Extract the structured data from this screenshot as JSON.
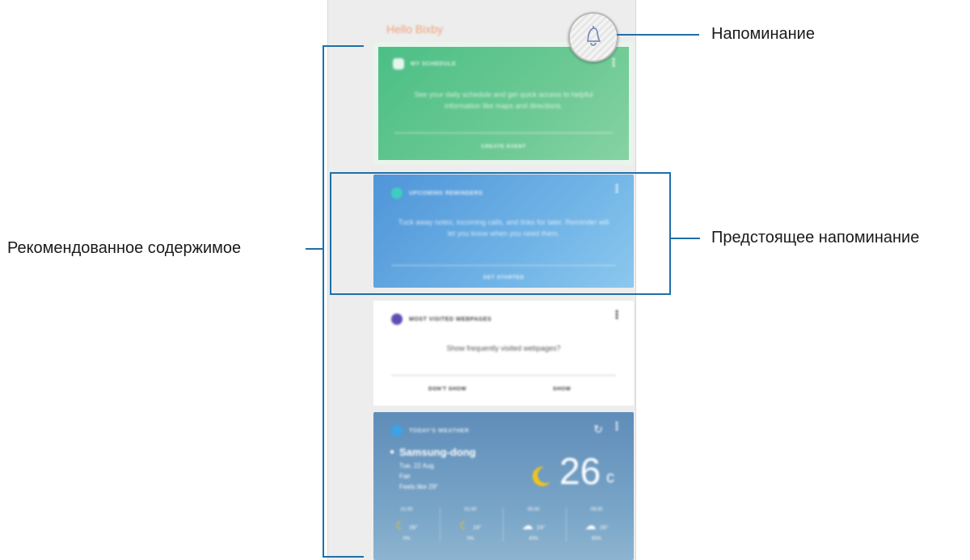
{
  "callouts": {
    "reminder": "Напоминание",
    "upcoming_reminder": "Предстоящее напоминание",
    "recommended_content": "Рекомендованное содержимое"
  },
  "screen": {
    "greeting": "Hello Bixby",
    "cards": [
      {
        "title": "MY SCHEDULE",
        "body": "See your daily schedule and get quick access to helpful information like maps and directions.",
        "action": "CREATE EVENT"
      },
      {
        "title": "UPCOMING REMINDERS",
        "body": "Tuck away notes, incoming calls, and links for later. Reminder will let you know when you need them.",
        "action": "GET STARTED"
      },
      {
        "title": "MOST VISITED WEBPAGES",
        "body": "Show frequently visited webpages?",
        "actions": [
          "DON'T SHOW",
          "SHOW"
        ]
      },
      {
        "title": "TODAY'S WEATHER",
        "location": "Samsung-dong",
        "date": "Tue, 22 Aug",
        "condition": "Fair",
        "feels_like": "Feels like 29°",
        "temperature": "26",
        "unit": "c",
        "forecast": [
          {
            "time": "21:00",
            "temp": "26°",
            "precip": "0%"
          },
          {
            "time": "01:00",
            "temp": "24°",
            "precip": "0%"
          },
          {
            "time": "05:00",
            "temp": "24°",
            "precip": "40%"
          },
          {
            "time": "09:00",
            "temp": "26°",
            "precip": "60%"
          }
        ]
      }
    ]
  },
  "colors": {
    "callout_line": "#1f6fa8",
    "green_card": "#55c28b",
    "blue_card": "#62a6e0",
    "weather_card": "#6a97bf",
    "greeting": "#f2a27a"
  },
  "icons": {
    "reminder": "bell-icon",
    "menu": "more-vert-icon",
    "refresh": "refresh-icon",
    "moon": "moon-icon",
    "rain": "rain-cloud-icon",
    "location": "location-pin-icon"
  }
}
